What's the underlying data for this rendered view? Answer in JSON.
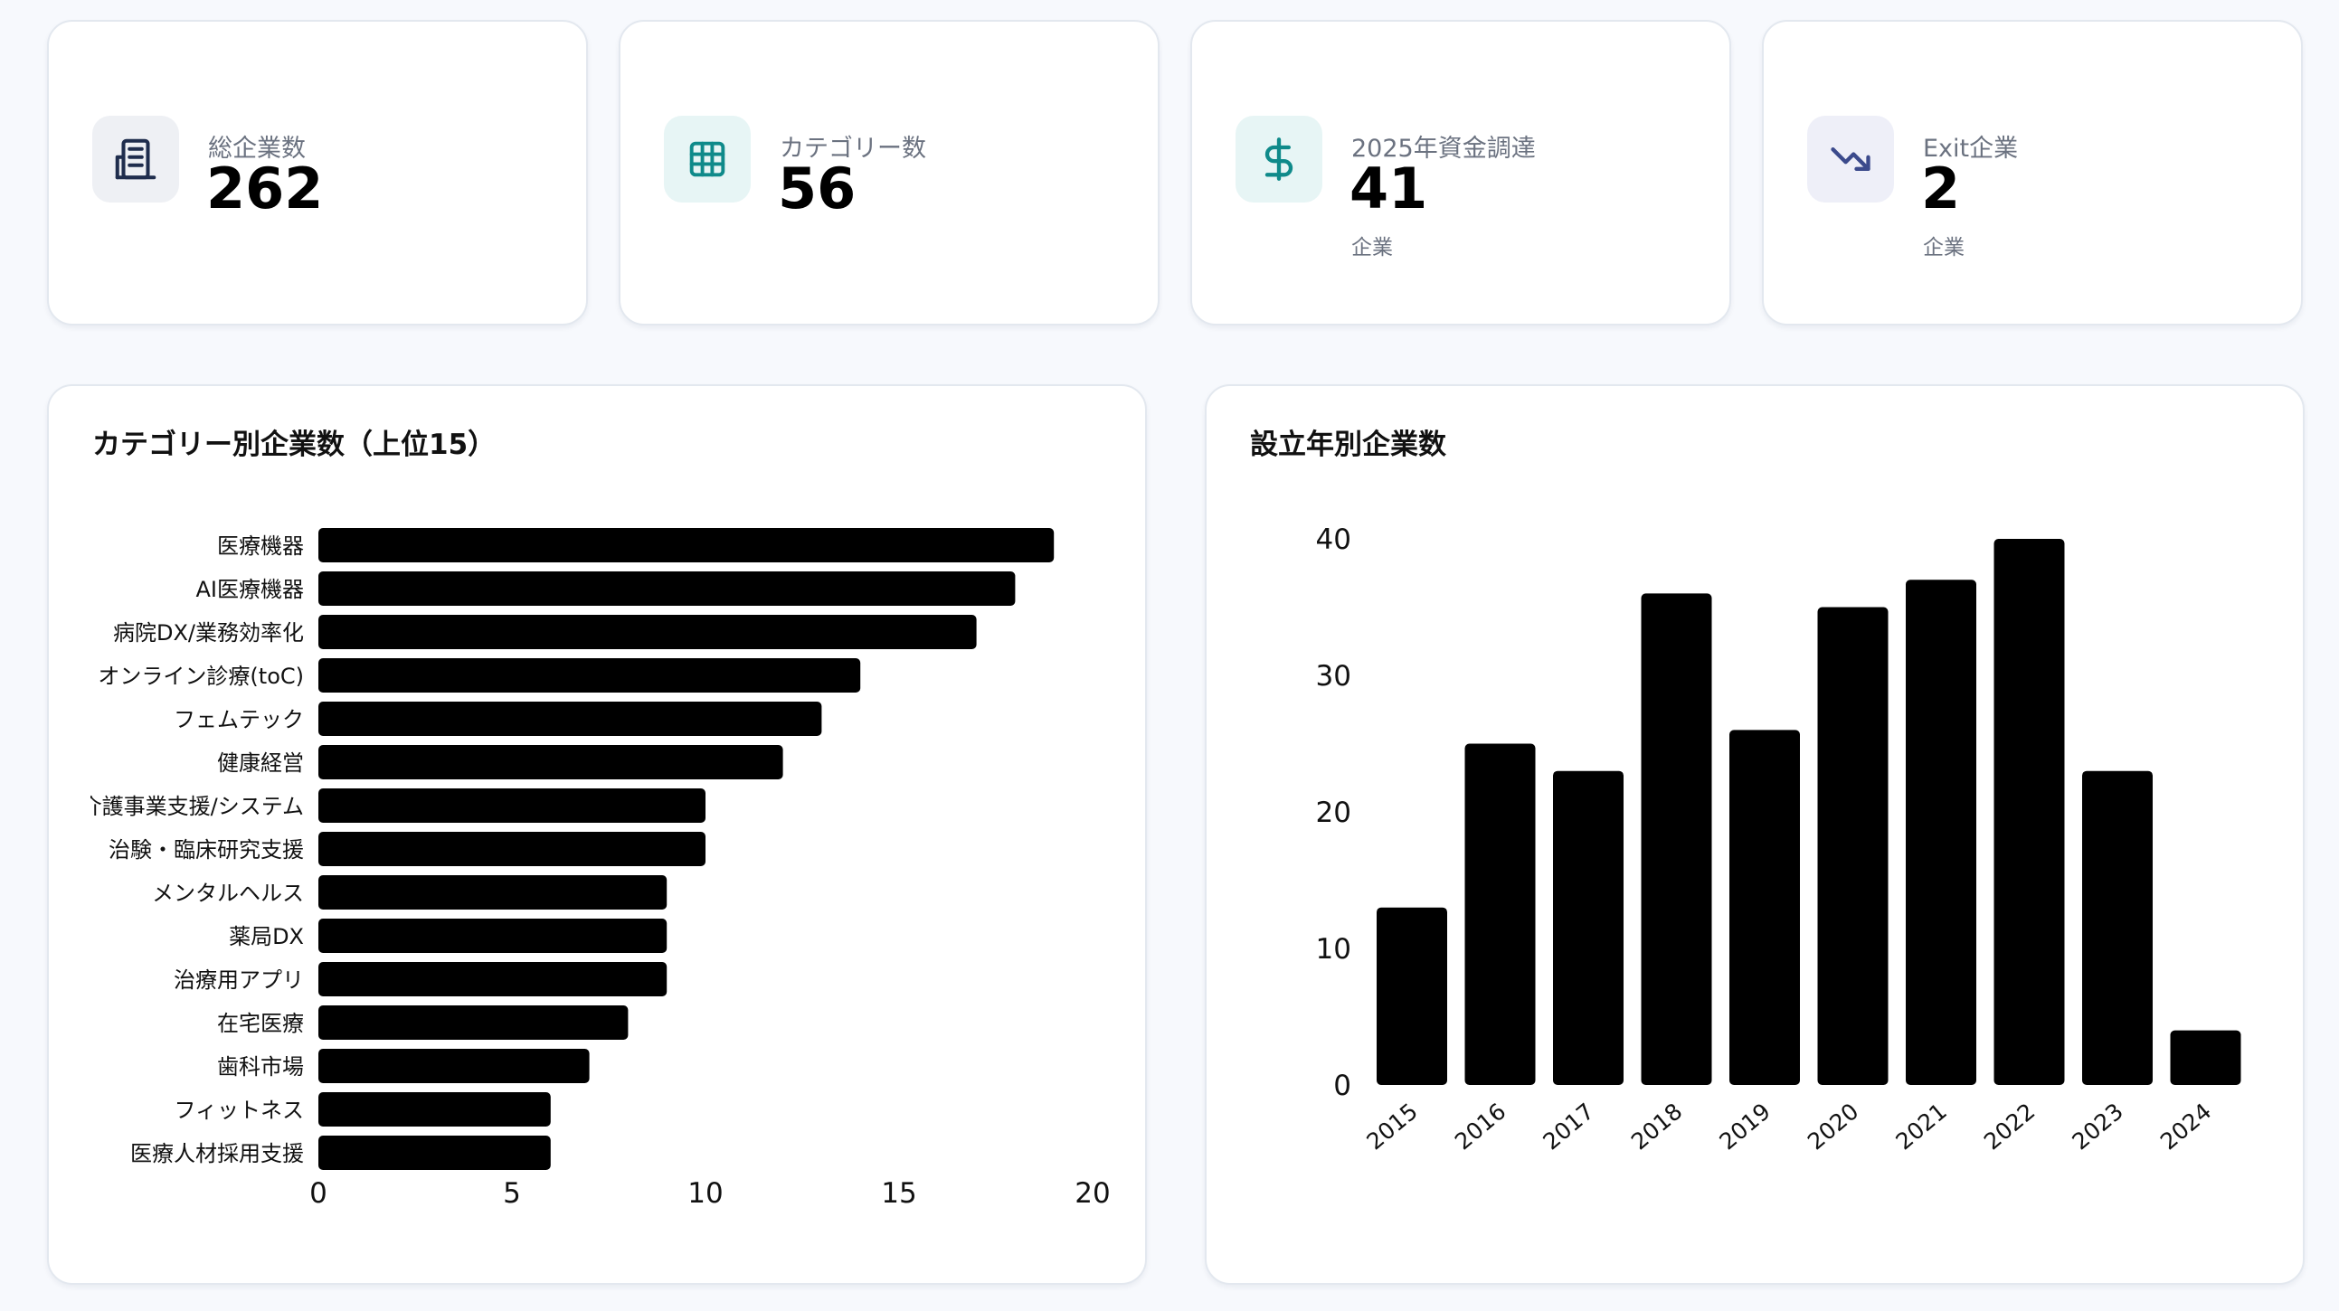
{
  "stats": [
    {
      "label": "総企業数",
      "value": "262",
      "unit": "",
      "icon": "building-icon",
      "icon_bg": "#eef0f4",
      "icon_color": "#1f2d4d"
    },
    {
      "label": "カテゴリー数",
      "value": "56",
      "unit": "",
      "icon": "grid-icon",
      "icon_bg": "#e7f5f5",
      "icon_color": "#0f8a8a"
    },
    {
      "label": "2025年資金調達",
      "value": "41",
      "unit": "企業",
      "icon": "dollar-icon",
      "icon_bg": "#e7f5f5",
      "icon_color": "#0f8a8a"
    },
    {
      "label": "Exit企業",
      "value": "2",
      "unit": "企業",
      "icon": "trending-down-icon",
      "icon_bg": "#eeeff8",
      "icon_color": "#3b4a8c"
    }
  ],
  "chart_data": [
    {
      "type": "bar",
      "orientation": "horizontal",
      "title": "カテゴリー別企業数（上位15）",
      "categories": [
        "医療機器",
        "AI医療機器",
        "病院DX/業務効率化",
        "オンライン診療(toC)",
        "フェムテック",
        "健康経営",
        "介護事業支援/システム",
        "治験・臨床研究支援",
        "メンタルヘルス",
        "薬局DX",
        "治療用アプリ",
        "在宅医療",
        "歯科市場",
        "フィットネス",
        "医療人材採用支援"
      ],
      "values": [
        19,
        18,
        17,
        14,
        13,
        12,
        10,
        10,
        9,
        9,
        9,
        8,
        7,
        6,
        6
      ],
      "xlim": [
        0,
        20
      ],
      "xticks": [
        0,
        5,
        10,
        15,
        20
      ],
      "bar_color": "#000000",
      "grid": false
    },
    {
      "type": "bar",
      "orientation": "vertical",
      "title": "設立年別企業数",
      "categories": [
        "2015",
        "2016",
        "2017",
        "2018",
        "2019",
        "2020",
        "2021",
        "2022",
        "2023",
        "2024"
      ],
      "values": [
        13,
        25,
        23,
        36,
        26,
        35,
        37,
        40,
        23,
        4
      ],
      "ylim": [
        0,
        40
      ],
      "yticks": [
        0,
        10,
        20,
        30,
        40
      ],
      "bar_color": "#000000",
      "grid": false
    }
  ]
}
